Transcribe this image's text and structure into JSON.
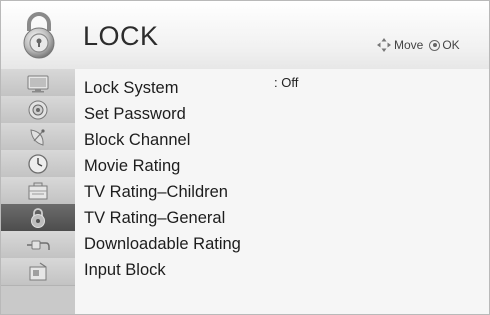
{
  "header": {
    "title": "LOCK",
    "hint_move": "Move",
    "hint_ok": "OK"
  },
  "sidebar": {
    "items": [
      {
        "icon": "tv-picture-icon",
        "active": false
      },
      {
        "icon": "audio-speaker-icon",
        "active": false
      },
      {
        "icon": "satellite-dish-icon",
        "active": false
      },
      {
        "icon": "clock-icon",
        "active": false
      },
      {
        "icon": "toolbox-option-icon",
        "active": false
      },
      {
        "icon": "lock-icon",
        "active": true
      },
      {
        "icon": "input-plug-icon",
        "active": false
      },
      {
        "icon": "usb-media-icon",
        "active": false
      }
    ]
  },
  "menu": {
    "items": [
      {
        "label": "Lock System",
        "value": ": Off"
      },
      {
        "label": "Set Password"
      },
      {
        "label": "Block Channel"
      },
      {
        "label": "Movie Rating"
      },
      {
        "label": "TV Rating–Children"
      },
      {
        "label": "TV Rating–General"
      },
      {
        "label": "Downloadable Rating"
      },
      {
        "label": "Input Block"
      }
    ]
  },
  "colors": {
    "header_bg": "#f1f1f1",
    "sidebar_bg": "#c9c9c9",
    "sidebar_active": "#555555",
    "text": "#1d1d1d"
  }
}
